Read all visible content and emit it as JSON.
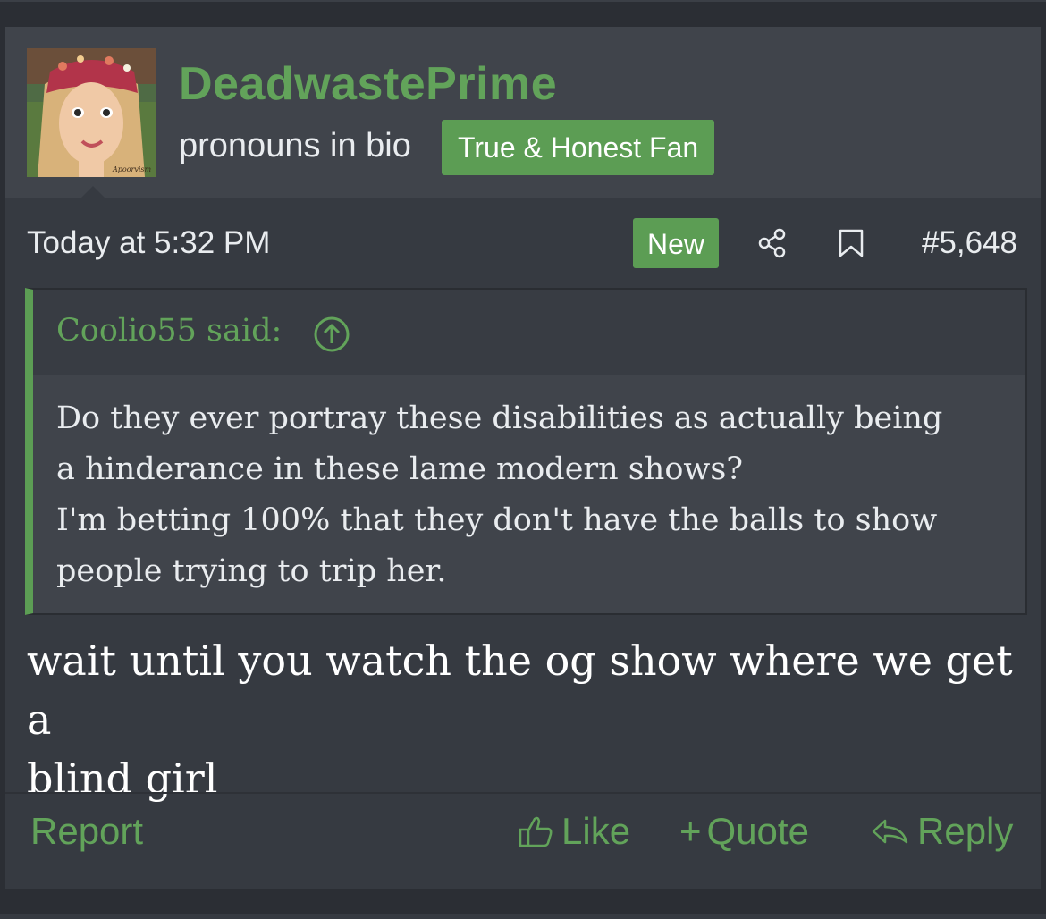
{
  "user": {
    "name": "DeadwastePrime",
    "pronouns": "pronouns in bio",
    "badge": "True & Honest Fan",
    "avatar_signature": "Apoorvism"
  },
  "meta": {
    "date": "Today at 5:32 PM",
    "new_label": "New",
    "post_number": "#5,648",
    "share_icon": "share-icon",
    "bookmark_icon": "bookmark-icon"
  },
  "quote": {
    "author": "Coolio55 said:",
    "lines": [
      "Do they ever portray these disabilities as actually being",
      "a hinderance in these lame modern shows?",
      "I'm betting 100% that they don't have the balls to show",
      "people trying to trip her."
    ]
  },
  "message": {
    "lines": [
      "wait until you watch the og show where we get a",
      "blind girl"
    ]
  },
  "actions": {
    "report": "Report",
    "like": "Like",
    "quote": "Quote",
    "reply": "Reply"
  },
  "colors": {
    "accent": "#62a35a",
    "badge": "#5c9d54",
    "background": "#363a41"
  }
}
